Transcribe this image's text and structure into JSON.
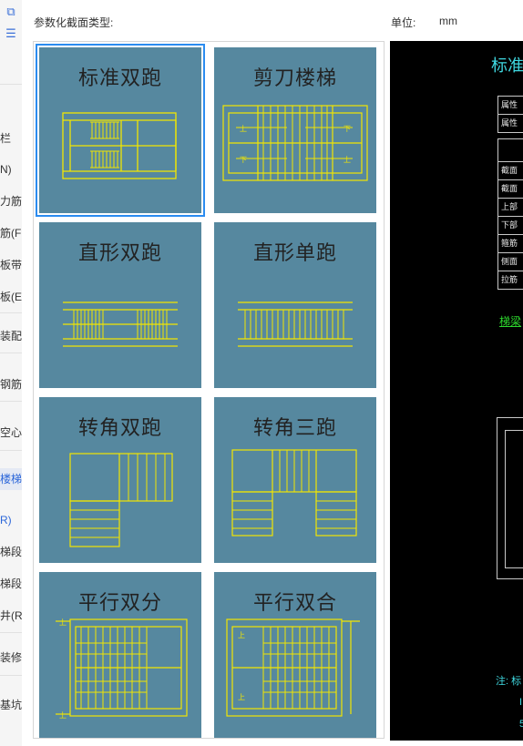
{
  "header": {
    "section_type_label": "参数化截面类型:",
    "unit_label": "单位:",
    "unit_value": "mm"
  },
  "sidebar": {
    "top_icons": [
      "copy-icon",
      "list-icon"
    ],
    "items": [
      {
        "label": "栏",
        "highlight": false
      },
      {
        "label": "N)",
        "highlight": false
      },
      {
        "label": "力筋",
        "highlight": false
      },
      {
        "label": "筋(F",
        "highlight": false
      },
      {
        "label": "板带",
        "highlight": false
      },
      {
        "label": "板(E",
        "highlight": false
      },
      {
        "label": "装配",
        "highlight": false
      },
      {
        "label": "钢筋",
        "highlight": false
      },
      {
        "label": "空心",
        "highlight": false
      },
      {
        "label": "楼梯",
        "highlight": true
      },
      {
        "label": "R)",
        "highlight": true
      },
      {
        "label": "梯段",
        "highlight": false
      },
      {
        "label": "梯段",
        "highlight": false
      },
      {
        "label": "井(R",
        "highlight": false
      },
      {
        "label": "装修",
        "highlight": false
      },
      {
        "label": "基坑",
        "highlight": false
      }
    ]
  },
  "tiles": [
    {
      "id": "standard-double",
      "label": "标准双跑",
      "selected": true
    },
    {
      "id": "scissor",
      "label": "剪刀楼梯",
      "selected": false
    },
    {
      "id": "straight-double",
      "label": "直形双跑",
      "selected": false
    },
    {
      "id": "straight-single",
      "label": "直形单跑",
      "selected": false
    },
    {
      "id": "corner-double",
      "label": "转角双跑",
      "selected": false
    },
    {
      "id": "corner-triple",
      "label": "转角三跑",
      "selected": false
    },
    {
      "id": "parallel-split",
      "label": "平行双分",
      "selected": false
    },
    {
      "id": "parallel-merge",
      "label": "平行双合",
      "selected": false
    }
  ],
  "preview": {
    "title": "标准",
    "rows1": [
      "属性",
      "属性"
    ],
    "rows2": [
      "",
      "截面",
      "截面",
      "上部",
      "下部",
      "箍筋",
      "侧面",
      "拉筋"
    ],
    "link": "梯梁",
    "note": "注: 标",
    "note2": "I",
    "note3": "5"
  },
  "colors": {
    "tile_background": "#56889f",
    "stair_lines": "#f2e600",
    "selection_border": "#2b8cf0",
    "preview_background": "#000000",
    "preview_title": "#3fd8e0",
    "preview_link": "#2dd62d"
  }
}
